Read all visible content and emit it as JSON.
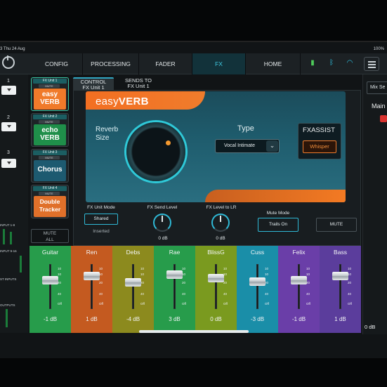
{
  "status": {
    "time": "3  Thu 24 Aug",
    "battery": "100%"
  },
  "nav": {
    "tabs": [
      {
        "label": "CONFIG"
      },
      {
        "label": "PROCESSING"
      },
      {
        "label": "FADER"
      },
      {
        "label": "FX"
      },
      {
        "label": "HOME"
      }
    ],
    "active": "FX",
    "status_icons": [
      "battery-icon",
      "bluetooth-icon",
      "wifi-icon",
      "menu-icon"
    ]
  },
  "left": {
    "numbers": [
      "1",
      "2",
      "3"
    ],
    "labels": [
      "INPUT 1-8",
      "INPUT 9-16",
      "ST INPUTS",
      "OUTPUTS"
    ]
  },
  "fx_slots": [
    {
      "header": "FX Unit 1",
      "mute": "MUTE",
      "name_lines": [
        "easy",
        "VERB"
      ]
    },
    {
      "header": "FX Unit 2",
      "mute": "MUTE",
      "name_lines": [
        "echo",
        "VERB"
      ]
    },
    {
      "header": "FX Unit 3",
      "mute": "MUTE",
      "name_lines": [
        "Chorus",
        ""
      ]
    },
    {
      "header": "FX Unit 4",
      "mute": "MUTE",
      "name_lines": [
        "Double",
        "Tracker"
      ]
    }
  ],
  "mute_all": {
    "line1": "MUTE",
    "line2": "ALL"
  },
  "control_tabs": [
    {
      "line1": "CONTROL",
      "line2": "FX Unit 1"
    },
    {
      "line1": "SENDS TO",
      "line2": "FX Unit 1"
    }
  ],
  "effect": {
    "title_light": "easy",
    "title_bold": "VERB",
    "knob_label_1": "Reverb",
    "knob_label_2": "Size",
    "type_label": "Type",
    "type_value": "Vocal Intimate",
    "assist_title": "FXASSIST",
    "assist_button": "Whisper",
    "knob_level": 0.78
  },
  "controls": {
    "unit_mode_label": "FX Unit Mode",
    "unit_mode_options": [
      "Shared",
      "Inserted"
    ],
    "unit_mode_selected": "Shared",
    "send_level_label": "FX Send Level",
    "send_level_value": "0 dB",
    "level_to_lr_label": "FX Level to LR",
    "level_to_lr_value": "0 dB",
    "mute_mode_label": "Mute Mode",
    "mute_mode_value": "Trails On",
    "mute_button": "MUTE"
  },
  "ticks": [
    "10",
    "10",
    "20",
    "40",
    "Off"
  ],
  "channels": [
    {
      "name": "Guitar",
      "db": "-1 dB",
      "color": "#279c4b",
      "level": 0.82
    },
    {
      "name": "Ren",
      "db": "1 dB",
      "color": "#c45a20",
      "level": 0.88
    },
    {
      "name": "Debs",
      "db": "-4 dB",
      "color": "#8c8a1e",
      "level": 0.78
    },
    {
      "name": "Rae",
      "db": "3 dB",
      "color": "#279c4b",
      "level": 0.9
    },
    {
      "name": "BlissG",
      "db": "0 dB",
      "color": "#7a9a1f",
      "level": 0.85
    },
    {
      "name": "Cuss",
      "db": "-3 dB",
      "color": "#1a8ea8",
      "level": 0.8
    },
    {
      "name": "Felix",
      "db": "-1 dB",
      "color": "#6a3ea8",
      "level": 0.82
    },
    {
      "name": "Bass",
      "db": "1 dB",
      "color": "#5b3d9c",
      "level": 0.88
    }
  ],
  "right": {
    "mix_button": "Mix Se",
    "main_label": "Main",
    "main_db": "0 dB"
  }
}
